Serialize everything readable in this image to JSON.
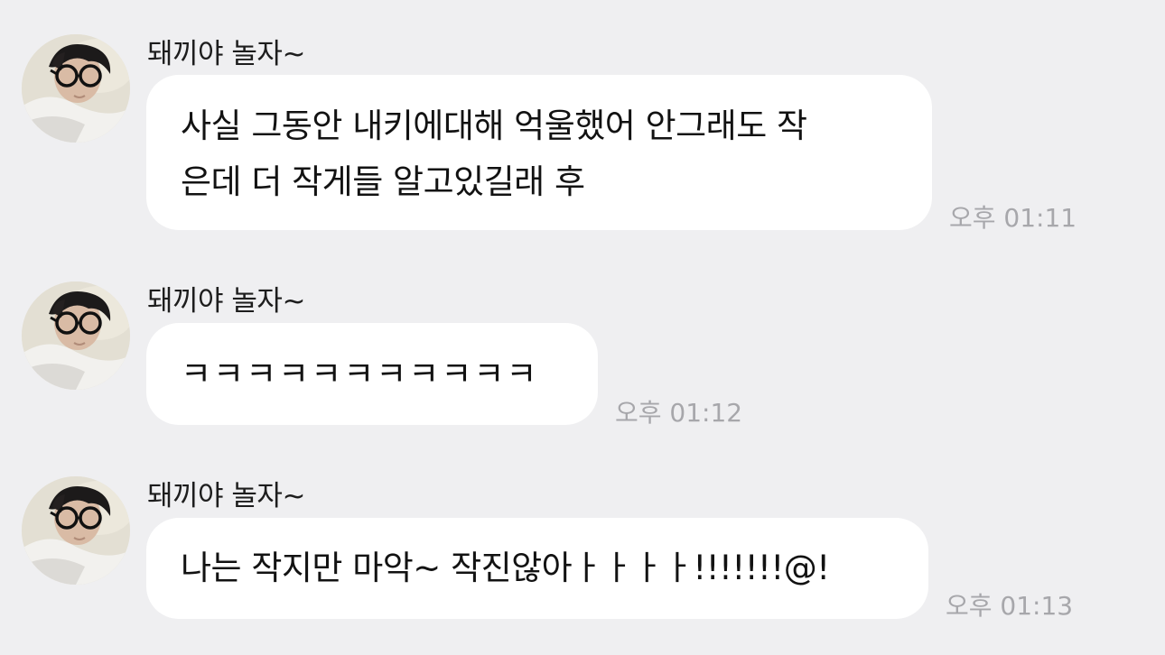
{
  "messages": [
    {
      "sender": "돼끼야 놀자~",
      "lines": [
        "사실 그동안 내키에대해 억울했어 안그래도 작",
        "은데 더 작게들 알고있길래 후"
      ],
      "time": "오후 01:11"
    },
    {
      "sender": "돼끼야 놀자~",
      "lines": [
        "ㅋㅋㅋㅋㅋㅋㅋㅋㅋㅋㅋ"
      ],
      "time": "오후 01:12"
    },
    {
      "sender": "돼끼야 놀자~",
      "lines": [
        "나는 작지만 마악~ 작진않아ㅏㅏㅏㅏ!!!!!!!@!"
      ],
      "time": "오후 01:13"
    }
  ],
  "colors": {
    "background": "#efeff1",
    "bubble": "#ffffff",
    "timestamp": "#a7a7ab"
  },
  "icons": {
    "avatar": "profile-photo-man-with-round-glasses"
  }
}
